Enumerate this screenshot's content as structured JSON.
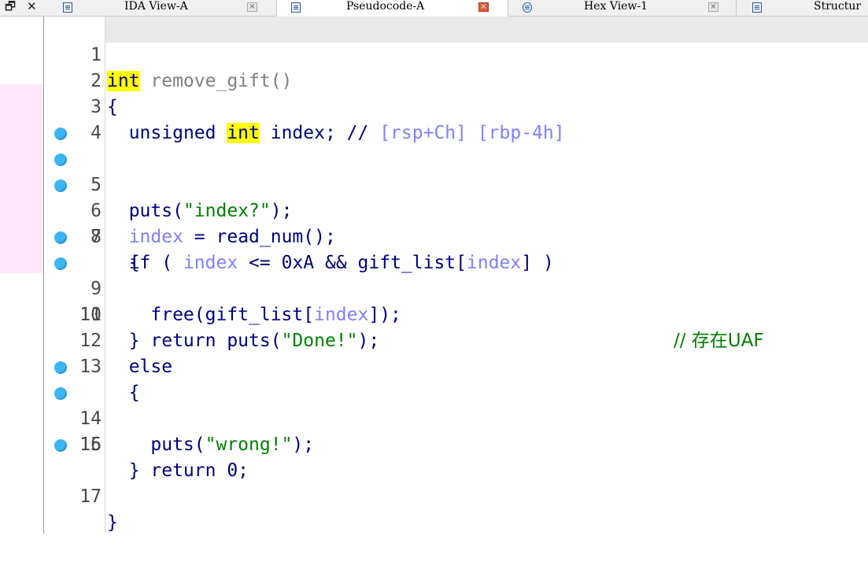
{
  "window": {
    "restore_glyph": "🗗",
    "close_glyph": "✕"
  },
  "tabs": [
    {
      "label": "IDA View-A",
      "icon": "listing-icon",
      "close": "×",
      "active": false
    },
    {
      "label": "Pseudocode-A",
      "icon": "pseudocode-icon",
      "close": "×",
      "active": true
    },
    {
      "label": "Hex View-1",
      "icon": "hex-icon",
      "close": "×",
      "active": false
    },
    {
      "label": "Structur",
      "icon": "structures-icon",
      "active": false
    }
  ],
  "colors": {
    "keyword": "#000080",
    "string": "#008000",
    "variable": "#8080ff",
    "comment": "#008000",
    "highlight": "#ffff00",
    "breakpoint": "#3bb6f0",
    "left_panel_highlight": "#fde8fb"
  },
  "code": {
    "lines": [
      {
        "no": "1",
        "parts": {
          "a": "int",
          "b": " remove_gift()"
        }
      },
      {
        "no": "2",
        "parts": {
          "a": "{"
        }
      },
      {
        "no": "3",
        "parts": {
          "a": "unsigned ",
          "b": "int",
          "c": " index; // ",
          "d": "[rsp+Ch] [rbp-4h]"
        }
      },
      {
        "no": "4",
        "parts": {}
      },
      {
        "no": "5",
        "breakpoint": true,
        "parts": {
          "a": "puts(",
          "b": "\"index?\"",
          "c": ");"
        }
      },
      {
        "no": "6",
        "breakpoint": true,
        "parts": {
          "a": "index",
          "b": " = read_num();"
        }
      },
      {
        "no": "7",
        "breakpoint": true,
        "parts": {
          "a": "if ( ",
          "b": "index",
          "c": " <= 0xA && gift_list[",
          "d": "index",
          "e": "] )"
        }
      },
      {
        "no": "8",
        "parts": {
          "a": "{"
        }
      },
      {
        "no": "9",
        "breakpoint": true,
        "parts": {
          "a": "free(gift_list[",
          "b": "index",
          "c": "]);"
        },
        "comment": "// 存在UAF"
      },
      {
        "no": "10",
        "breakpoint": true,
        "parts": {
          "a": "return puts(",
          "b": "\"Done!\"",
          "c": ");"
        }
      },
      {
        "no": "11",
        "parts": {
          "a": "}"
        }
      },
      {
        "no": "12",
        "parts": {
          "a": "else"
        }
      },
      {
        "no": "13",
        "parts": {
          "a": "{"
        }
      },
      {
        "no": "14",
        "breakpoint": true,
        "parts": {
          "a": "puts(",
          "b": "\"wrong!\"",
          "c": ");"
        }
      },
      {
        "no": "15",
        "breakpoint": true,
        "parts": {
          "a": "return 0;"
        }
      },
      {
        "no": "16",
        "parts": {
          "a": "}"
        }
      },
      {
        "no": "17",
        "breakpoint": true,
        "parts": {
          "a": "}"
        }
      }
    ]
  }
}
